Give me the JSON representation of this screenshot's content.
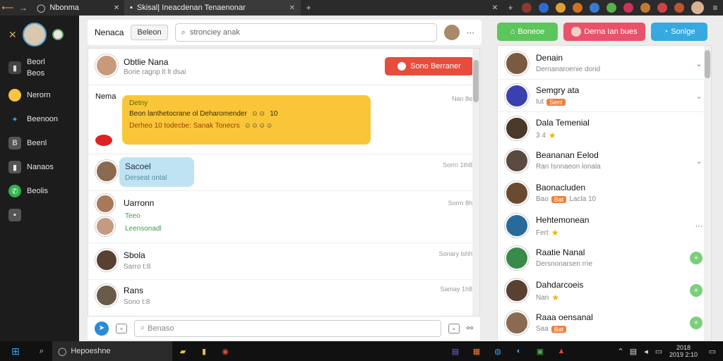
{
  "browser": {
    "tabs": [
      {
        "title": "Nbonma"
      },
      {
        "title": "Skisal| Ineacdenan Tenaenonar"
      }
    ],
    "new_tab": "+"
  },
  "sidebar": {
    "items": [
      {
        "label": "Beorl",
        "sub": "Beos"
      },
      {
        "label": "Nerorn"
      },
      {
        "label": "Beenoon"
      },
      {
        "label": "Beenl"
      },
      {
        "label": "Nanaos"
      },
      {
        "label": "Beolis"
      }
    ]
  },
  "header": {
    "title": "Nenaca",
    "button": "Beleon",
    "search_placeholder": "stronciey anak"
  },
  "chats": [
    {
      "name": "Obtlie Nana",
      "sub": "Borie ragnp lt lt dsai",
      "action": "Sono Berraner"
    },
    {
      "name": "Nema",
      "time": "Nan 8e",
      "bubble_title": "Detny",
      "bubble_line1": "Beon lanthetocrane ol Deharomender",
      "bubble_line2": "Derheo 10 todecbe: Sanak Tonecrs",
      "bubble_num": "10"
    },
    {
      "name": "Sacoel",
      "sub": "Derseat ontal",
      "time": "Sorrn 1th8"
    },
    {
      "name": "Uarronn",
      "sub1": "Teeo",
      "sub2": "Leensonadl",
      "time": "Sorrn 8h"
    },
    {
      "name": "Sbola",
      "sub": "Sarro t:8",
      "time": "Sonary lshh"
    },
    {
      "name": "Rans",
      "sub": "Sono t:8",
      "time": "Samay 1h8"
    }
  ],
  "composer": {
    "placeholder": "Benaso"
  },
  "right_buttons": [
    {
      "label": "Boneoe",
      "color": "#5cc65c"
    },
    {
      "label": "Derna Ian bues",
      "color": "#e8526a"
    },
    {
      "label": "Sonlge",
      "color": "#38a8e0"
    }
  ],
  "contacts": [
    {
      "name": "Denain",
      "sub": "Dernanaroenie dorid"
    },
    {
      "name": "Semgry ata",
      "sub": "Iut",
      "tag": "Sent"
    },
    {
      "name": "Dala Temenial",
      "sub": "3 4"
    },
    {
      "name": "Beananan Eelod",
      "sub": "Ran Isnnaeon lonala"
    },
    {
      "name": "Baonacluden",
      "sub": "Bao",
      "tag": "Bat",
      "extra": "Lacla 10"
    },
    {
      "name": "Hehtemonean",
      "sub": "Fert"
    },
    {
      "name": "Raatie Nanal",
      "sub": "Dersnonarsen rrie"
    },
    {
      "name": "Dahdarcoeis",
      "sub": "Nan"
    },
    {
      "name": "Raaa oensanal",
      "sub": "Saa",
      "tag": "Bat"
    }
  ],
  "taskbar": {
    "search": "Hepoeshne",
    "clock_time": "2018",
    "clock_date": "2019 2:10"
  }
}
